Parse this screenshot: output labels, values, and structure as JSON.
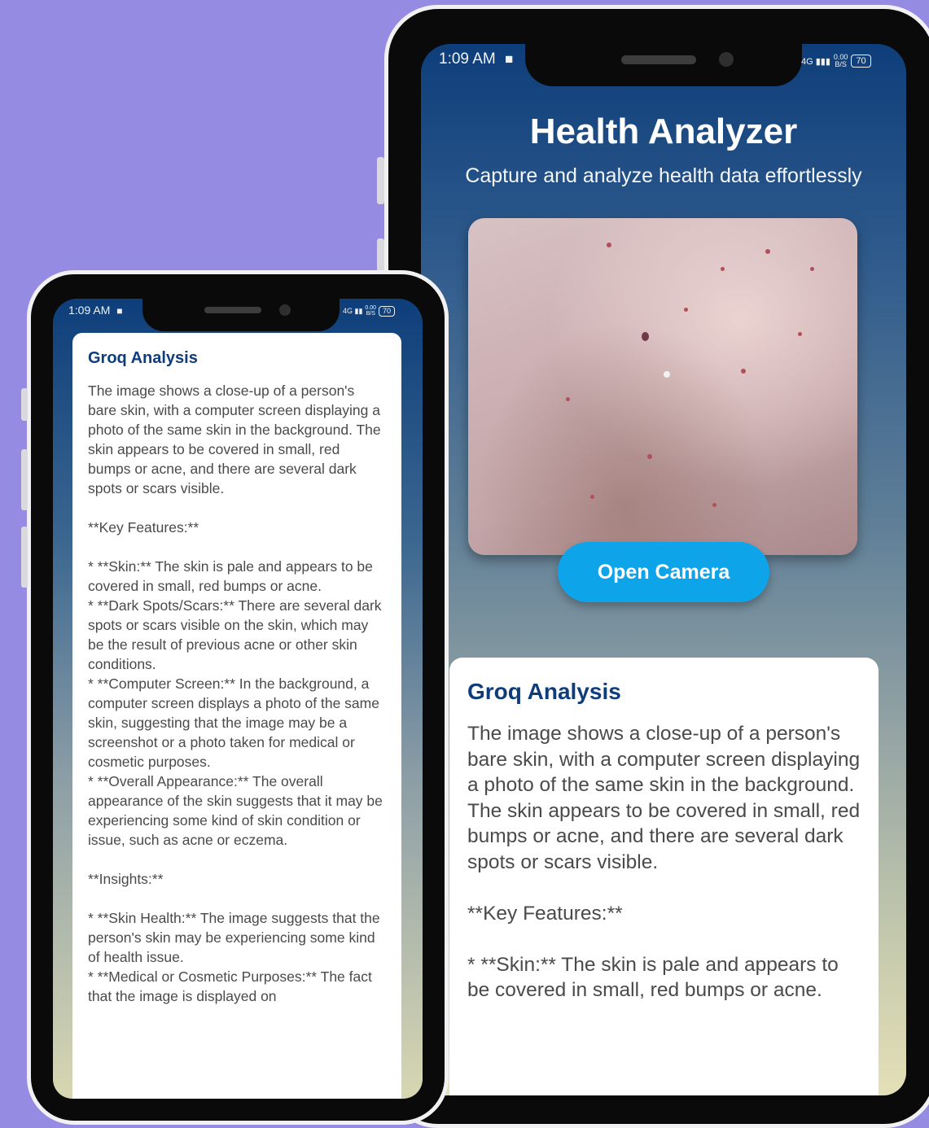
{
  "status_bar": {
    "time": "1:09 AM",
    "signal": "4G",
    "speed_value": "0.00",
    "speed_unit": "B/S",
    "battery": "70"
  },
  "header": {
    "title": "Health Analyzer",
    "subtitle": "Capture and analyze health data effortlessly"
  },
  "actions": {
    "open_camera": "Open Camera"
  },
  "analysis": {
    "title": "Groq Analysis",
    "text_visible_large": "The image shows a close-up of a person's bare skin, with a computer screen displaying a photo of the same skin in the background. The skin appears to be covered in small, red bumps or acne, and there are several dark spots or scars visible.\n\n**Key Features:**\n\n* **Skin:** The skin is pale and appears to be covered in small, red bumps or acne.",
    "text_visible_small": "The image shows a close-up of a person's bare skin, with a computer screen displaying a photo of the same skin in the background. The skin appears to be covered in small, red bumps or acne, and there are several dark spots or scars visible.\n\n**Key Features:**\n\n* **Skin:** The skin is pale and appears to be covered in small, red bumps or acne.\n* **Dark Spots/Scars:** There are several dark spots or scars visible on the skin, which may be the result of previous acne or other skin conditions.\n* **Computer Screen:** In the background, a computer screen displays a photo of the same skin, suggesting that the image may be a screenshot or a photo taken for medical or cosmetic purposes.\n* **Overall Appearance:** The overall appearance of the skin suggests that it may be experiencing some kind of skin condition or issue, such as acne or eczema.\n\n**Insights:**\n\n* **Skin Health:** The image suggests that the person's skin may be experiencing some kind of health issue.\n* **Medical or Cosmetic Purposes:** The fact that the image is displayed on"
  },
  "colors": {
    "background": "#968be3",
    "accent_button": "#0ea4ea",
    "title_blue": "#0f3c7a"
  }
}
